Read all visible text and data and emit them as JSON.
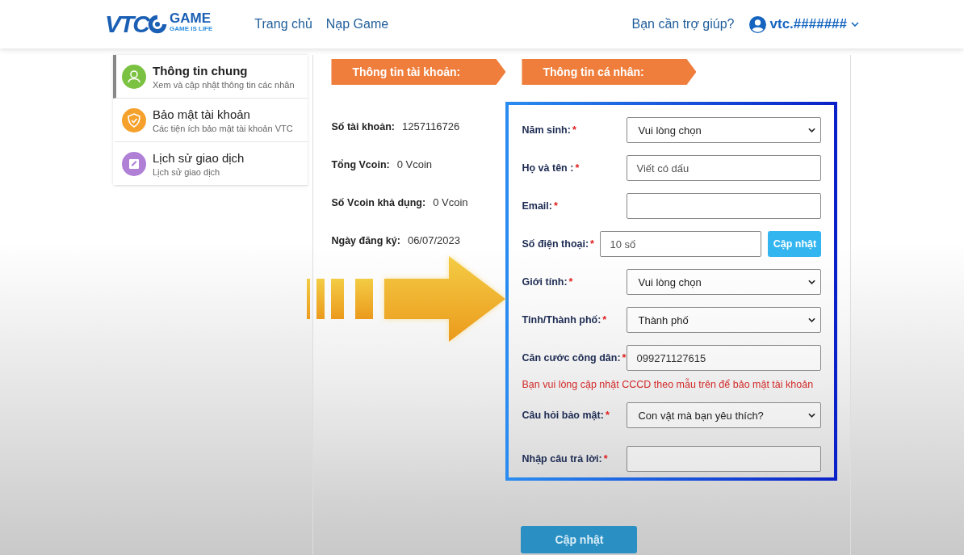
{
  "header": {
    "logo": {
      "brand": "VTC",
      "word": "GAME",
      "slogan": "GAME IS LIFE"
    },
    "nav": [
      {
        "label": "Trang chủ"
      },
      {
        "label": "Nạp Game"
      }
    ],
    "help": "Bạn cần trợ giúp?",
    "user": "vtc.#######"
  },
  "sidebar": {
    "items": [
      {
        "title": "Thông tin chung",
        "subtitle": "Xem và cập nhật thông tin các nhân",
        "selected": true,
        "color": "#7cc242"
      },
      {
        "title": "Bảo mật tài khoản",
        "subtitle": "Các tiện ích bảo mật tài khoản VTC",
        "selected": false,
        "color": "#f5a12c"
      },
      {
        "title": "Lịch sử giao dịch",
        "subtitle": "Lịch sử giao dịch",
        "selected": false,
        "color": "#b07fd6"
      }
    ]
  },
  "account": {
    "heading": "Thông tin tài khoản:",
    "rows": [
      {
        "label": "Số tài khoản:",
        "value": "1257116726"
      },
      {
        "label": "Tổng Vcoin:",
        "value": "0 Vcoin"
      },
      {
        "label": "Số Vcoin khả dụng:",
        "value": "0 Vcoin"
      },
      {
        "label": "Ngày đăng ký:",
        "value": "06/07/2023"
      }
    ]
  },
  "personal": {
    "heading": "Thông tin cá nhân:",
    "fields": [
      {
        "kind": "select",
        "label": "Năm sinh:",
        "mark": "*",
        "value": "Vui lòng chọn"
      },
      {
        "kind": "input",
        "label": "Họ và tên :",
        "mark": "*",
        "placeholder": "Viết có dấu"
      },
      {
        "kind": "input",
        "label": "Email:",
        "mark": "*"
      },
      {
        "kind": "input",
        "label": "Số điện thoại:",
        "mark": "*",
        "placeholder": "10 số",
        "button": "Cập nhật"
      },
      {
        "kind": "select",
        "label": "Giới tính:",
        "mark": "*",
        "value": "Vui lòng chọn"
      },
      {
        "kind": "select",
        "label": "Tỉnh/Thành phố:",
        "mark": "*",
        "value": "Thành phố"
      },
      {
        "kind": "input",
        "label": "Căn cước công dân: ",
        "mark": "*",
        "value": "099271127615"
      },
      {
        "kind": "note",
        "text": "Bạn vui lòng cập nhật CCCD theo mẫu trên để bảo mật tài khoản"
      },
      {
        "kind": "select",
        "label": "Câu hỏi bảo mật:",
        "mark": "*",
        "value": "Con vật mà bạn yêu thích?"
      },
      {
        "kind": "input",
        "label": "Nhập câu trả lời:",
        "mark": "*"
      }
    ]
  },
  "submit": "Cập nhật"
}
